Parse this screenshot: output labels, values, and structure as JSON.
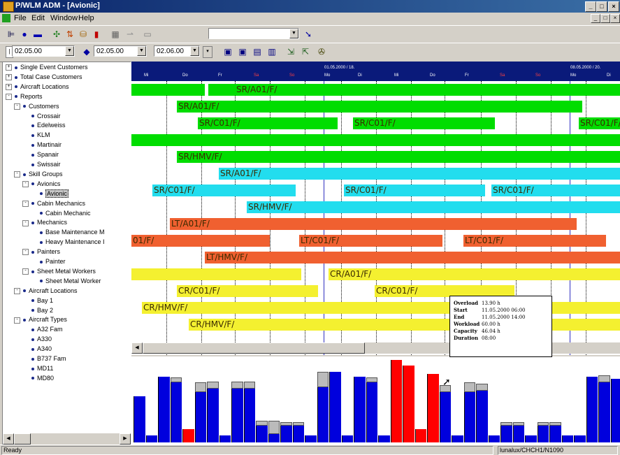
{
  "window": {
    "title": "P/WLM ADM - [Avionic]",
    "min": "_",
    "max": "□",
    "close": "×"
  },
  "menu": {
    "items": [
      "File",
      "Edit",
      "Window",
      "Help"
    ]
  },
  "toolbar1": {
    "combo_value": ""
  },
  "toolbar2": {
    "from_value": "02.05.00",
    "to_value": "02.05.00",
    "date_value": "02.06.00"
  },
  "tree": {
    "nodes": [
      {
        "label": "Single Event Customers",
        "level": 0,
        "expander": "+"
      },
      {
        "label": "Total Case Customers",
        "level": 0,
        "expander": "+"
      },
      {
        "label": "Aircraft Locations",
        "level": 0,
        "expander": "+"
      },
      {
        "label": "Reports",
        "level": 0,
        "expander": "-"
      },
      {
        "label": "Customers",
        "level": 1,
        "expander": "-"
      },
      {
        "label": "Crossair",
        "level": 2,
        "expander": ""
      },
      {
        "label": "Edelweiss",
        "level": 2,
        "expander": ""
      },
      {
        "label": "KLM",
        "level": 2,
        "expander": ""
      },
      {
        "label": "Martinair",
        "level": 2,
        "expander": ""
      },
      {
        "label": "Spanair",
        "level": 2,
        "expander": ""
      },
      {
        "label": "Swissair",
        "level": 2,
        "expander": ""
      },
      {
        "label": "Skill Groups",
        "level": 1,
        "expander": "-"
      },
      {
        "label": "Avionics",
        "level": 2,
        "expander": "-"
      },
      {
        "label": "Avionic",
        "level": 3,
        "expander": "",
        "selected": true
      },
      {
        "label": "Cabin Mechanics",
        "level": 2,
        "expander": "-"
      },
      {
        "label": "Cabin Mechanic",
        "level": 3,
        "expander": ""
      },
      {
        "label": "Mechanics",
        "level": 2,
        "expander": "-"
      },
      {
        "label": "Base Maintenance M",
        "level": 3,
        "expander": ""
      },
      {
        "label": "Heavy Maintenance I",
        "level": 3,
        "expander": ""
      },
      {
        "label": "Painters",
        "level": 2,
        "expander": "-"
      },
      {
        "label": "Painter",
        "level": 3,
        "expander": ""
      },
      {
        "label": "Sheet Metal Workers",
        "level": 2,
        "expander": "-"
      },
      {
        "label": "Sheet Metal Worker",
        "level": 3,
        "expander": ""
      },
      {
        "label": "Aircraft Locations",
        "level": 1,
        "expander": "-"
      },
      {
        "label": "Bay 1",
        "level": 2,
        "expander": ""
      },
      {
        "label": "Bay 2",
        "level": 2,
        "expander": ""
      },
      {
        "label": "Aircraft Types",
        "level": 1,
        "expander": "-"
      },
      {
        "label": "A32 Fam",
        "level": 2,
        "expander": ""
      },
      {
        "label": "A330",
        "level": 2,
        "expander": ""
      },
      {
        "label": "A340",
        "level": 2,
        "expander": ""
      },
      {
        "label": "B737 Fam",
        "level": 2,
        "expander": ""
      },
      {
        "label": "MD11",
        "level": 2,
        "expander": ""
      },
      {
        "label": "MD80",
        "level": 2,
        "expander": ""
      }
    ]
  },
  "gantt": {
    "week_labels": [
      "01.05.2000 / 18.",
      "08.05.2000 / 20."
    ],
    "day_labels": [
      "Mi",
      "Do",
      "Fr",
      "Sa",
      "So",
      "Mo",
      "Di",
      "Mi",
      "Do",
      "Fr",
      "Sa",
      "So",
      "Mo",
      "Di"
    ],
    "colors": {
      "green": "#00dd00",
      "cyan": "#22ddee",
      "orange": "#f06030",
      "yellow": "#f4f030"
    },
    "rows": [
      [
        {
          "c": "green",
          "t": ""
        },
        {
          "c": "green",
          "t": "SR/A01/F/"
        }
      ],
      [
        {
          "c": "green",
          "t": "SR/A01/F/"
        }
      ],
      [
        {
          "c": "green",
          "t": "SR/C01/F/"
        },
        {
          "c": "green",
          "t": "SR/C01/F/"
        },
        {
          "c": "green",
          "t": "SR/C01/F/"
        }
      ],
      [
        {
          "c": "green",
          "t": ""
        }
      ],
      [
        {
          "c": "green",
          "t": "SR/HMV/F/"
        }
      ],
      [
        {
          "c": "cyan",
          "t": "SR/A01/F/"
        }
      ],
      [
        {
          "c": "cyan",
          "t": "SR/C01/F/"
        },
        {
          "c": "cyan",
          "t": "SR/C01/F/"
        },
        {
          "c": "cyan",
          "t": "SR/C01/F/"
        }
      ],
      [
        {
          "c": "cyan",
          "t": "SR/HMV/F/"
        }
      ],
      [
        {
          "c": "orange",
          "t": "LT/A01/F/"
        }
      ],
      [
        {
          "c": "orange",
          "t": "01/F/"
        },
        {
          "c": "orange",
          "t": "LT/C01/F/"
        },
        {
          "c": "orange",
          "t": "LT/C01/F/"
        }
      ],
      [
        {
          "c": "orange",
          "t": "LT/HMV/F/"
        }
      ],
      [
        {
          "c": "yellow",
          "t": ""
        },
        {
          "c": "yellow",
          "t": "CR/A01/F/"
        }
      ],
      [
        {
          "c": "yellow",
          "t": "CR/C01/F/"
        },
        {
          "c": "yellow",
          "t": "CR/C01/F/"
        }
      ],
      [
        {
          "c": "yellow",
          "t": "CR/HMV/F/"
        }
      ],
      [
        {
          "c": "yellow",
          "t": "CR/HMV/F/"
        }
      ]
    ]
  },
  "histogram": {
    "legend_colors": {
      "capacity": "#0000dd",
      "overload": "#ff0000",
      "free": "#bbbbbb"
    },
    "bars": [
      {
        "load": 0.55,
        "free": 0.0,
        "status": "normal"
      },
      {
        "load": 0.08,
        "free": 0.0,
        "status": "normal"
      },
      {
        "load": 0.78,
        "free": 0.0,
        "status": "normal"
      },
      {
        "load": 0.72,
        "free": 0.06,
        "status": "normal"
      },
      {
        "load": 0.16,
        "free": 0.0,
        "status": "overload"
      },
      {
        "load": 0.6,
        "free": 0.12,
        "status": "normal"
      },
      {
        "load": 0.64,
        "free": 0.08,
        "status": "normal"
      },
      {
        "load": 0.08,
        "free": 0.0,
        "status": "normal"
      },
      {
        "load": 0.64,
        "free": 0.08,
        "status": "normal"
      },
      {
        "load": 0.64,
        "free": 0.08,
        "status": "normal"
      },
      {
        "load": 0.2,
        "free": 0.06,
        "status": "normal"
      },
      {
        "load": 0.1,
        "free": 0.16,
        "status": "normal"
      },
      {
        "load": 0.2,
        "free": 0.04,
        "status": "normal"
      },
      {
        "load": 0.2,
        "free": 0.04,
        "status": "normal"
      },
      {
        "load": 0.08,
        "free": 0.0,
        "status": "normal"
      },
      {
        "load": 0.66,
        "free": 0.18,
        "status": "normal"
      },
      {
        "load": 0.84,
        "free": 0.0,
        "status": "normal"
      },
      {
        "load": 0.08,
        "free": 0.0,
        "status": "normal"
      },
      {
        "load": 0.78,
        "free": 0.0,
        "status": "normal"
      },
      {
        "load": 0.72,
        "free": 0.06,
        "status": "normal"
      },
      {
        "load": 0.08,
        "free": 0.0,
        "status": "normal"
      },
      {
        "load": 0.98,
        "free": 0.0,
        "status": "overload"
      },
      {
        "load": 0.92,
        "free": 0.0,
        "status": "overload"
      },
      {
        "load": 0.16,
        "free": 0.0,
        "status": "overload"
      },
      {
        "load": 0.82,
        "free": 0.0,
        "status": "overload"
      },
      {
        "load": 0.6,
        "free": 0.08,
        "status": "normal"
      },
      {
        "load": 0.08,
        "free": 0.0,
        "status": "normal"
      },
      {
        "load": 0.6,
        "free": 0.12,
        "status": "normal"
      },
      {
        "load": 0.62,
        "free": 0.08,
        "status": "normal"
      },
      {
        "load": 0.08,
        "free": 0.0,
        "status": "normal"
      },
      {
        "load": 0.2,
        "free": 0.04,
        "status": "normal"
      },
      {
        "load": 0.2,
        "free": 0.04,
        "status": "normal"
      },
      {
        "load": 0.08,
        "free": 0.0,
        "status": "normal"
      },
      {
        "load": 0.2,
        "free": 0.04,
        "status": "normal"
      },
      {
        "load": 0.2,
        "free": 0.04,
        "status": "normal"
      },
      {
        "load": 0.08,
        "free": 0.0,
        "status": "normal"
      },
      {
        "load": 0.08,
        "free": 0.0,
        "status": "normal"
      },
      {
        "load": 0.78,
        "free": 0.0,
        "status": "normal"
      },
      {
        "load": 0.72,
        "free": 0.08,
        "status": "normal"
      },
      {
        "load": 0.76,
        "free": 0.0,
        "status": "normal"
      }
    ]
  },
  "tooltip": {
    "rows": [
      {
        "k": "Overload",
        "v": "13.90 h"
      },
      {
        "k": "Start",
        "v": "11.05.2000 06:00"
      },
      {
        "k": "End",
        "v": "11.05.2000 14:00"
      },
      {
        "k": "Workload",
        "v": "60.00 h"
      },
      {
        "k": "Capacity",
        "v": "46.04 h"
      },
      {
        "k": "Duration",
        "v": "08:00"
      }
    ]
  },
  "status": {
    "left": "Ready",
    "right": "lunalux/CHCH1/N1090"
  }
}
